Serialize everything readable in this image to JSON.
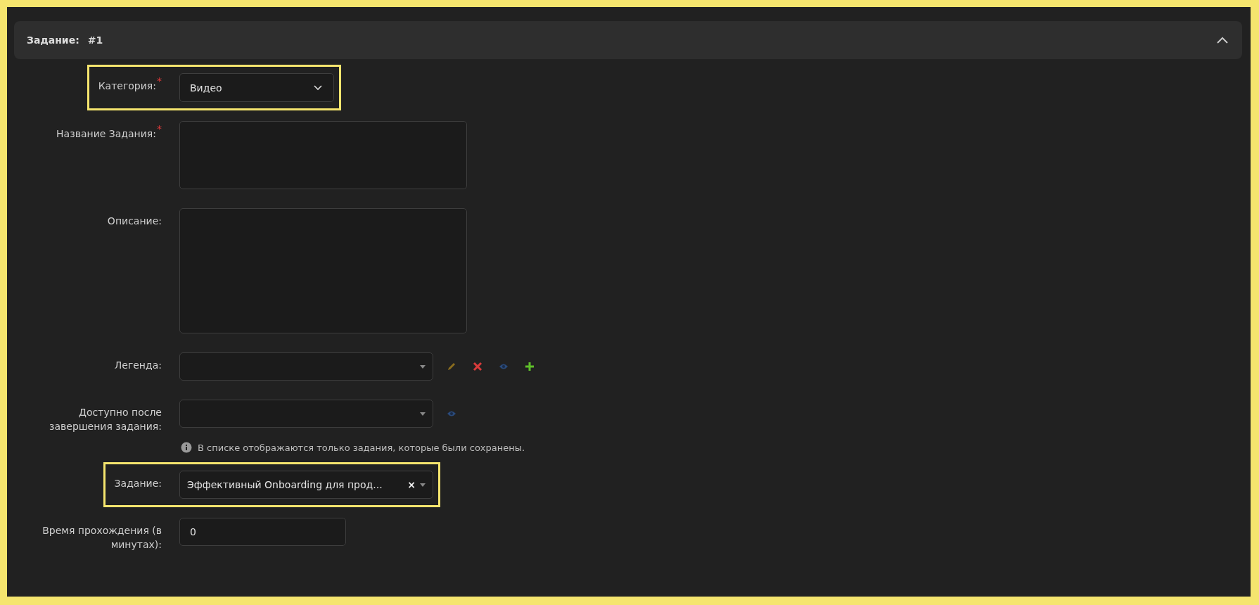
{
  "panel": {
    "title": "Задание:",
    "number": "#1",
    "expanded": true
  },
  "fields": [
    {
      "kind": "select",
      "label": "Категория:",
      "required_mark": "*",
      "value": "Видео",
      "highlighted": true
    },
    {
      "kind": "textarea",
      "label": "Название Задания:",
      "required_mark": "*"
    },
    {
      "kind": "memo",
      "label": "Описание:"
    },
    {
      "kind": "combo",
      "label": "Легенда:",
      "actions": [
        {
          "kind": "edit"
        },
        {
          "kind": "delete"
        },
        {
          "kind": "view"
        },
        {
          "kind": "add"
        }
      ]
    },
    {
      "kind": "combo",
      "label": "Доступно после завершения задания:",
      "actions": [
        {
          "kind": "view"
        }
      ],
      "note": "В списке отображаются только задания, которые были сохранены."
    },
    {
      "kind": "combo",
      "label": "Задание:",
      "value": "Эффективный Onboarding для прод...",
      "clear": "×",
      "highlighted": true
    },
    {
      "kind": "input",
      "label": "Время прохождения (в минутах):",
      "value": "0"
    }
  ]
}
